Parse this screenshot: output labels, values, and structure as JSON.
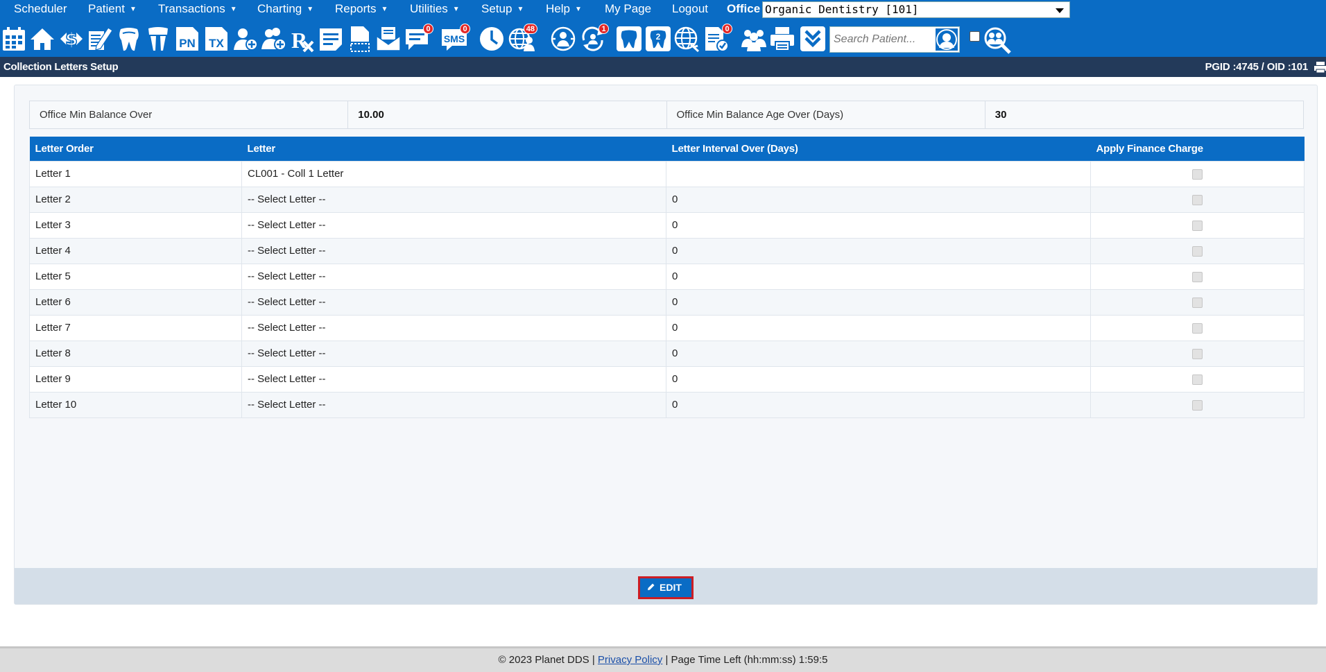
{
  "menu": {
    "items": [
      {
        "label": "Scheduler",
        "caret": false
      },
      {
        "label": "Patient",
        "caret": true
      },
      {
        "label": "Transactions",
        "caret": true
      },
      {
        "label": "Charting",
        "caret": true
      },
      {
        "label": "Reports",
        "caret": true
      },
      {
        "label": "Utilities",
        "caret": true
      },
      {
        "label": "Setup",
        "caret": true
      },
      {
        "label": "Help",
        "caret": true
      },
      {
        "label": "My Page",
        "caret": false
      },
      {
        "label": "Logout",
        "caret": false
      }
    ],
    "office_label": "Office",
    "office_value": "Organic Dentistry [101]"
  },
  "toolbar": {
    "icons": [
      "calendar-icon",
      "home-icon",
      "dollar-icon",
      "edit-form-icon",
      "tooth-icon",
      "teeth-icon",
      "pn-icon",
      "tx-icon",
      "add-patient-icon",
      "add-patients-icon",
      "rx-icon",
      "notes-icon",
      "document-icon",
      "mail-icon",
      "chat-icon",
      "sms-icon",
      "clock-icon",
      "globe-user-icon",
      "globe-support-icon",
      "sync-user-icon",
      "tooth-outline-icon",
      "tooth-2-icon",
      "globe-network-icon",
      "document-check-icon",
      "group-icon",
      "printer-icon",
      "chevrons-down-icon"
    ],
    "badges": {
      "chat": "0",
      "sms": "0",
      "globe_user": "48",
      "sync_user": "1",
      "document_check": "0"
    },
    "pn_text": "PN",
    "tx_text": "TX",
    "sms_text": "SMS",
    "tooth_number": "2",
    "search_placeholder": "Search Patient..."
  },
  "titlebar": {
    "title": "Collection Letters Setup",
    "ids": "PGID :4745  /  OID :101"
  },
  "summary": {
    "min_balance_label": "Office Min Balance Over",
    "min_balance_value": "10.00",
    "min_age_label": "Office Min Balance Age Over (Days)",
    "min_age_value": "30"
  },
  "table": {
    "headers": [
      "Letter Order",
      "Letter",
      "Letter Interval Over (Days)",
      "Apply Finance Charge"
    ],
    "rows": [
      {
        "order": "Letter 1",
        "letter": "CL001 - Coll 1 Letter",
        "interval": "",
        "finance": false
      },
      {
        "order": "Letter 2",
        "letter": "-- Select Letter --",
        "interval": "0",
        "finance": false
      },
      {
        "order": "Letter 3",
        "letter": "-- Select Letter --",
        "interval": "0",
        "finance": false
      },
      {
        "order": "Letter 4",
        "letter": "-- Select Letter --",
        "interval": "0",
        "finance": false
      },
      {
        "order": "Letter 5",
        "letter": "-- Select Letter --",
        "interval": "0",
        "finance": false
      },
      {
        "order": "Letter 6",
        "letter": "-- Select Letter --",
        "interval": "0",
        "finance": false
      },
      {
        "order": "Letter 7",
        "letter": "-- Select Letter --",
        "interval": "0",
        "finance": false
      },
      {
        "order": "Letter 8",
        "letter": "-- Select Letter --",
        "interval": "0",
        "finance": false
      },
      {
        "order": "Letter 9",
        "letter": "-- Select Letter --",
        "interval": "0",
        "finance": false
      },
      {
        "order": "Letter 10",
        "letter": "-- Select Letter --",
        "interval": "0",
        "finance": false
      }
    ]
  },
  "actions": {
    "edit_label": "EDIT"
  },
  "footer": {
    "copyright": "© 2023 Planet DDS |",
    "privacy": "Privacy Policy",
    "time_left": "|  Page Time Left (hh:mm:ss) 1:59:5"
  },
  "colors": {
    "brand_blue": "#0a6cc5",
    "title_bar": "#233a5a",
    "badge_red": "#e32626",
    "edit_border": "#cc1d24"
  }
}
